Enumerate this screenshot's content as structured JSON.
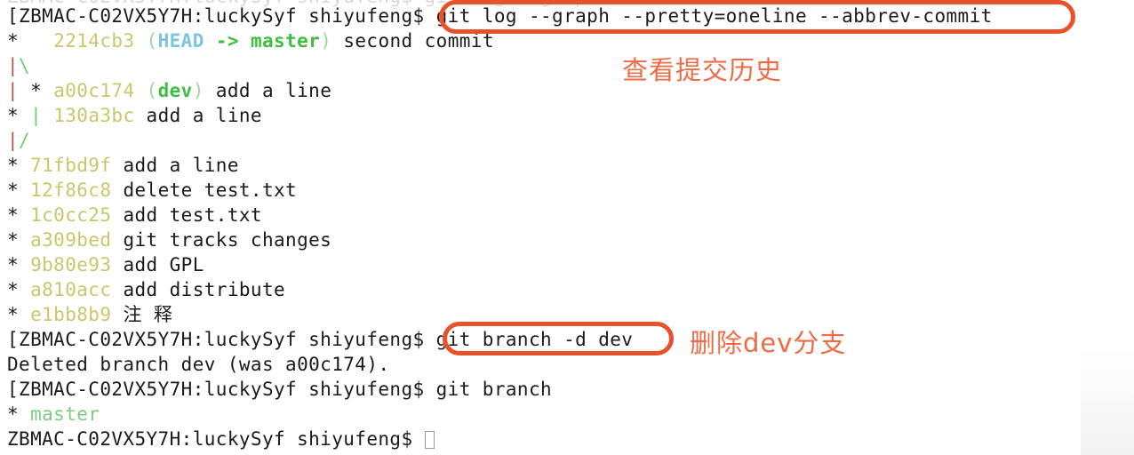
{
  "terminal": {
    "prompt": "ZBMAC-C02VX5Y7H:luckySyf shiyufeng$ ",
    "prompt_bracket": "[",
    "cutoff_top_text": "ZBMAC-C02VX5Y7H:luckySyf shiyufeng$ git log --graph",
    "commands": {
      "git_log": "git log --graph --pretty=oneline --abbrev-commit",
      "git_branch_delete": "git branch -d dev",
      "git_branch": "git branch"
    },
    "log_graph": [
      {
        "graph": "*   ",
        "hash": "2214cb3",
        "ref_open": " (",
        "ref_head": "HEAD",
        "ref_arrow": " -> ",
        "ref_branch": "master",
        "ref_close": ") ",
        "message": "second commit"
      },
      {
        "graph_red": "|",
        "graph_green": "\\",
        "hash": "",
        "message": ""
      },
      {
        "graph_red": "| ",
        "graph_star": "* ",
        "hash": "a00c174",
        "ref_open": " (",
        "ref_branch": "dev",
        "ref_close": ") ",
        "message": "add a line"
      },
      {
        "graph_star": "* ",
        "graph_green": "| ",
        "hash": "130a3bc",
        "message": " add a line"
      },
      {
        "graph_red": "|",
        "graph_green": "/",
        "hash": "",
        "message": ""
      },
      {
        "graph_star": "* ",
        "hash": "71fbd9f",
        "message": " add a line"
      },
      {
        "graph_star": "* ",
        "hash": "12f86c8",
        "message": " delete test.txt"
      },
      {
        "graph_star": "* ",
        "hash": "1c0cc25",
        "message": " add test.txt"
      },
      {
        "graph_star": "* ",
        "hash": "a309bed",
        "message": " git tracks changes"
      },
      {
        "graph_star": "* ",
        "hash": "9b80e93",
        "message": " add GPL"
      },
      {
        "graph_star": "* ",
        "hash": "a810acc",
        "message": " add distribute"
      },
      {
        "graph_star": "* ",
        "hash": "e1bb8b9",
        "message": " 注 释"
      }
    ],
    "delete_output": "Deleted branch dev (was a00c174).",
    "branch_list_star": "* ",
    "branch_list_name": "master",
    "final_prompt_cursor": ""
  },
  "annotations": [
    {
      "text": "查看提交历史",
      "color": "#ef6b45"
    },
    {
      "text": "删除dev分支",
      "color": "#ef6b45"
    }
  ],
  "colors": {
    "highlight_box": "#e8522a",
    "annotation_text": "#ef6b45",
    "commit_hash": "#c8c86a",
    "branch_green": "#3fbf3f",
    "head_cyan": "#79c6de",
    "graph_red": "#b5504a",
    "graph_green": "#6fce6f",
    "background": "#ffffff",
    "text": "#1a1a1a"
  }
}
